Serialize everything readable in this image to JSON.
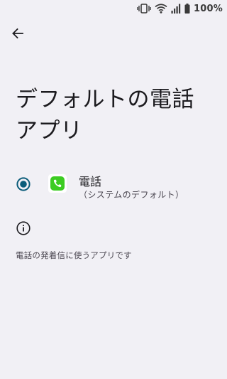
{
  "status_bar": {
    "battery_percent": "100%",
    "icons": [
      "vibrate-icon",
      "wifi-icon",
      "signal-icon",
      "battery-icon"
    ]
  },
  "header": {
    "back_icon": "arrow-back-icon"
  },
  "page": {
    "title_line1": "デフォルトの電話",
    "title_line2": "アプリ"
  },
  "option": {
    "app_name": "電話",
    "app_subtitle": "（システムのデフォルト）",
    "selected": true
  },
  "footer": {
    "info_icon": "info-icon",
    "description": "電話の発着信に使うアプリです"
  },
  "colors": {
    "background": "#f1f0f5",
    "radio_accent": "#0b5c7a",
    "app_icon_green": "#3ccc22"
  }
}
